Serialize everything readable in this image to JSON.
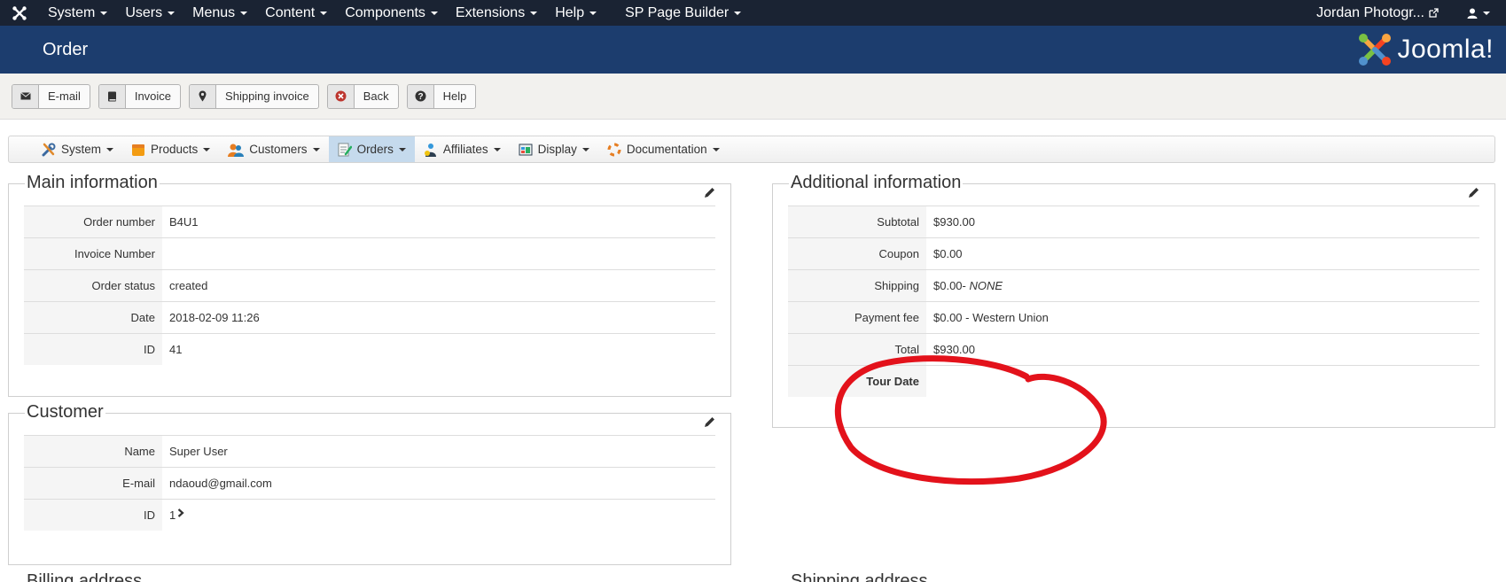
{
  "navbar": {
    "menu": [
      {
        "label": "System"
      },
      {
        "label": "Users"
      },
      {
        "label": "Menus"
      },
      {
        "label": "Content"
      },
      {
        "label": "Components"
      },
      {
        "label": "Extensions"
      },
      {
        "label": "Help"
      },
      {
        "label": "SP Page Builder"
      }
    ],
    "site_link": "Jordan Photogr...",
    "user_icon": "user-icon"
  },
  "header": {
    "title": "Order",
    "logo_text": "Joomla!"
  },
  "toolbar": {
    "buttons": [
      {
        "label": "E-mail",
        "icon": "envelope-icon"
      },
      {
        "label": "Invoice",
        "icon": "book-icon"
      },
      {
        "label": "Shipping invoice",
        "icon": "map-marker-icon"
      },
      {
        "label": "Back",
        "icon": "cancel-icon"
      },
      {
        "label": "Help",
        "icon": "question-icon"
      }
    ]
  },
  "submenu": {
    "items": [
      {
        "label": "System"
      },
      {
        "label": "Products"
      },
      {
        "label": "Customers"
      },
      {
        "label": "Orders",
        "active": true
      },
      {
        "label": "Affiliates"
      },
      {
        "label": "Display"
      },
      {
        "label": "Documentation"
      }
    ]
  },
  "main_info": {
    "title": "Main information",
    "rows": [
      {
        "label": "Order number",
        "value": "B4U1"
      },
      {
        "label": "Invoice Number",
        "value": ""
      },
      {
        "label": "Order status",
        "value": "created"
      },
      {
        "label": "Date",
        "value": "2018-02-09 11:26"
      },
      {
        "label": "ID",
        "value": "41"
      }
    ]
  },
  "customer": {
    "title": "Customer",
    "rows": [
      {
        "label": "Name",
        "value": "Super User"
      },
      {
        "label": "E-mail",
        "value": "ndaoud@gmail.com"
      },
      {
        "label": "ID",
        "value": "1"
      }
    ]
  },
  "additional_info": {
    "title": "Additional information",
    "rows": [
      {
        "label": "Subtotal",
        "value": "$930.00"
      },
      {
        "label": "Coupon",
        "value": "$0.00"
      },
      {
        "label": "Shipping",
        "value": "$0.00- ",
        "value_italic": "NONE"
      },
      {
        "label": "Payment fee",
        "value": "$0.00 - Western Union"
      },
      {
        "label": "Total",
        "value": "$930.00"
      },
      {
        "label": "Tour Date",
        "value": ""
      }
    ]
  },
  "billing_title": "Billing address",
  "shipping_title": "Shipping address",
  "colors": {
    "navbar": "#1a2333",
    "header": "#1c3d6e",
    "annotation": "#e3121b"
  }
}
